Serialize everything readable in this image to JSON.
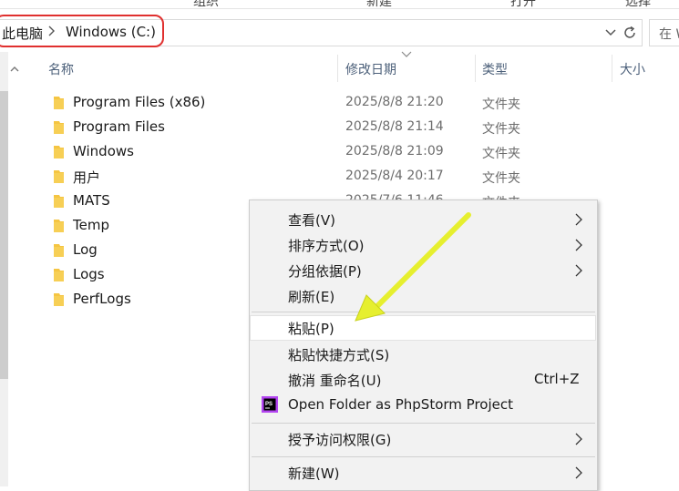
{
  "ribbon": {
    "items": [
      "组织",
      "新建",
      "打开",
      "选择"
    ]
  },
  "address": {
    "crumbs": [
      "此电脑",
      "Windows (C:)"
    ],
    "search_placeholder": "在 W"
  },
  "columns": {
    "name": "名称",
    "date": "修改日期",
    "type": "类型",
    "size": "大小"
  },
  "files": [
    {
      "name": "Program Files (x86)",
      "date": "2025/8/8 21:20",
      "type": "文件夹"
    },
    {
      "name": "Program Files",
      "date": "2025/8/8 21:14",
      "type": "文件夹"
    },
    {
      "name": "Windows",
      "date": "2025/8/8 21:09",
      "type": "文件夹"
    },
    {
      "name": "用户",
      "date": "2025/8/4 20:17",
      "type": "文件夹"
    },
    {
      "name": "MATS",
      "date": "2025/7/6 11:46",
      "type": "文件夹"
    },
    {
      "name": "Temp",
      "date": "",
      "type": ""
    },
    {
      "name": "Log",
      "date": "",
      "type": ""
    },
    {
      "name": "Logs",
      "date": "",
      "type": ""
    },
    {
      "name": "PerfLogs",
      "date": "",
      "type": ""
    }
  ],
  "menu": {
    "view": "查看(V)",
    "sort": "排序方式(O)",
    "group": "分组依据(P)",
    "refresh": "刷新(E)",
    "paste": "粘贴(P)",
    "paste_shortcut": "粘贴快捷方式(S)",
    "undo": "撤消 重命名(U)",
    "undo_accel": "Ctrl+Z",
    "phpstorm": "Open Folder as PhpStorm Project",
    "grant": "授予访问权限(G)",
    "new": "新建(W)"
  },
  "colors": {
    "highlight_border": "#e0302f",
    "annotation_arrow": "#e6ef2f",
    "folder": "#f5c542"
  }
}
